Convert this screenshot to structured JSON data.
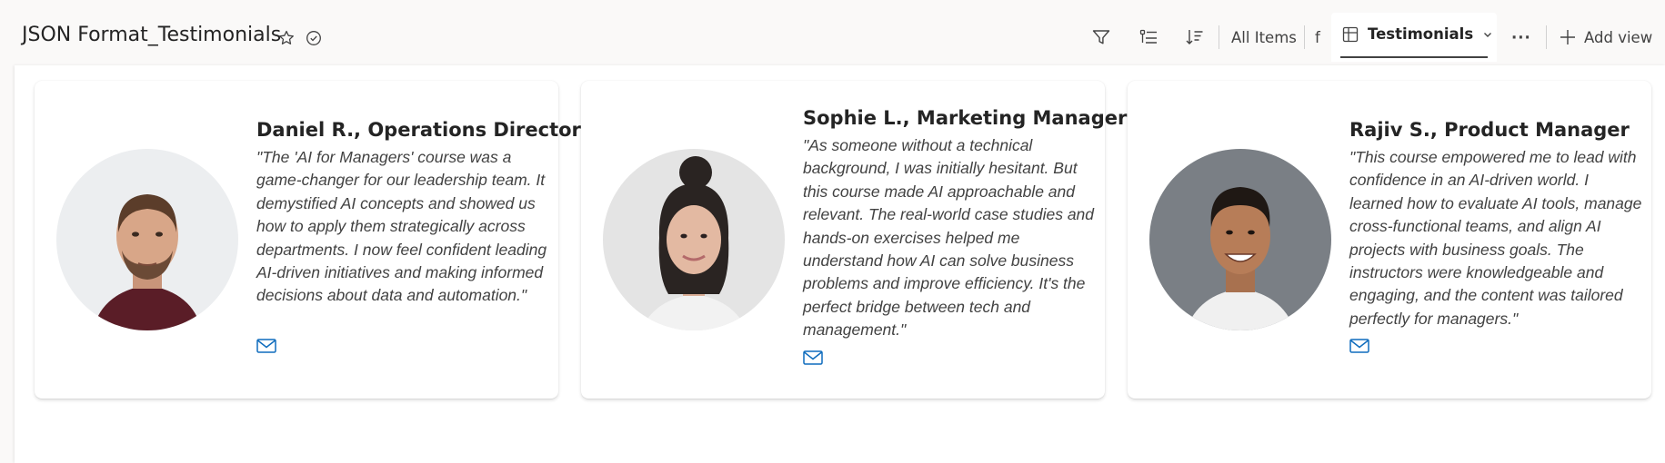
{
  "header": {
    "title": "JSON Format_Testimonials",
    "all_items": "All Items",
    "f_label": "f",
    "active_view": "Testimonials",
    "more": "···",
    "add_view": "Add view"
  },
  "icons": {
    "favorite": "star-icon",
    "status": "check-circle-icon",
    "filter": "filter-icon",
    "group": "list-icon",
    "sort": "sort-icon",
    "view": "grid-icon",
    "add": "plus-icon",
    "email": "mail-icon"
  },
  "colors": {
    "accent": "#0f6cbd",
    "text": "#242424",
    "quote": "#424242"
  },
  "testimonials": [
    {
      "name": "Daniel R., Operations Director",
      "quote": "\"The 'AI for Managers' course was a game-changer for our leadership team. It demystified AI concepts and showed us how to apply them strategically across departments. I now feel confident leading AI-driven initiatives and making informed decisions about data and automation.\""
    },
    {
      "name": "Sophie L., Marketing Manager",
      "quote": "\"As someone without a technical background, I was initially hesitant. But this course made AI approachable and relevant. The real-world case studies and hands-on exercises helped me understand how AI can solve business problems and improve efficiency. It's the perfect bridge between tech and management.\""
    },
    {
      "name": "Rajiv S., Product Manager",
      "quote": "\"This course empowered me to lead with confidence in an AI-driven world. I learned how to evaluate AI tools, manage cross-functional teams, and align AI projects with business goals. The instructors were knowledgeable and engaging, and the content was tailored perfectly for managers.\""
    }
  ]
}
